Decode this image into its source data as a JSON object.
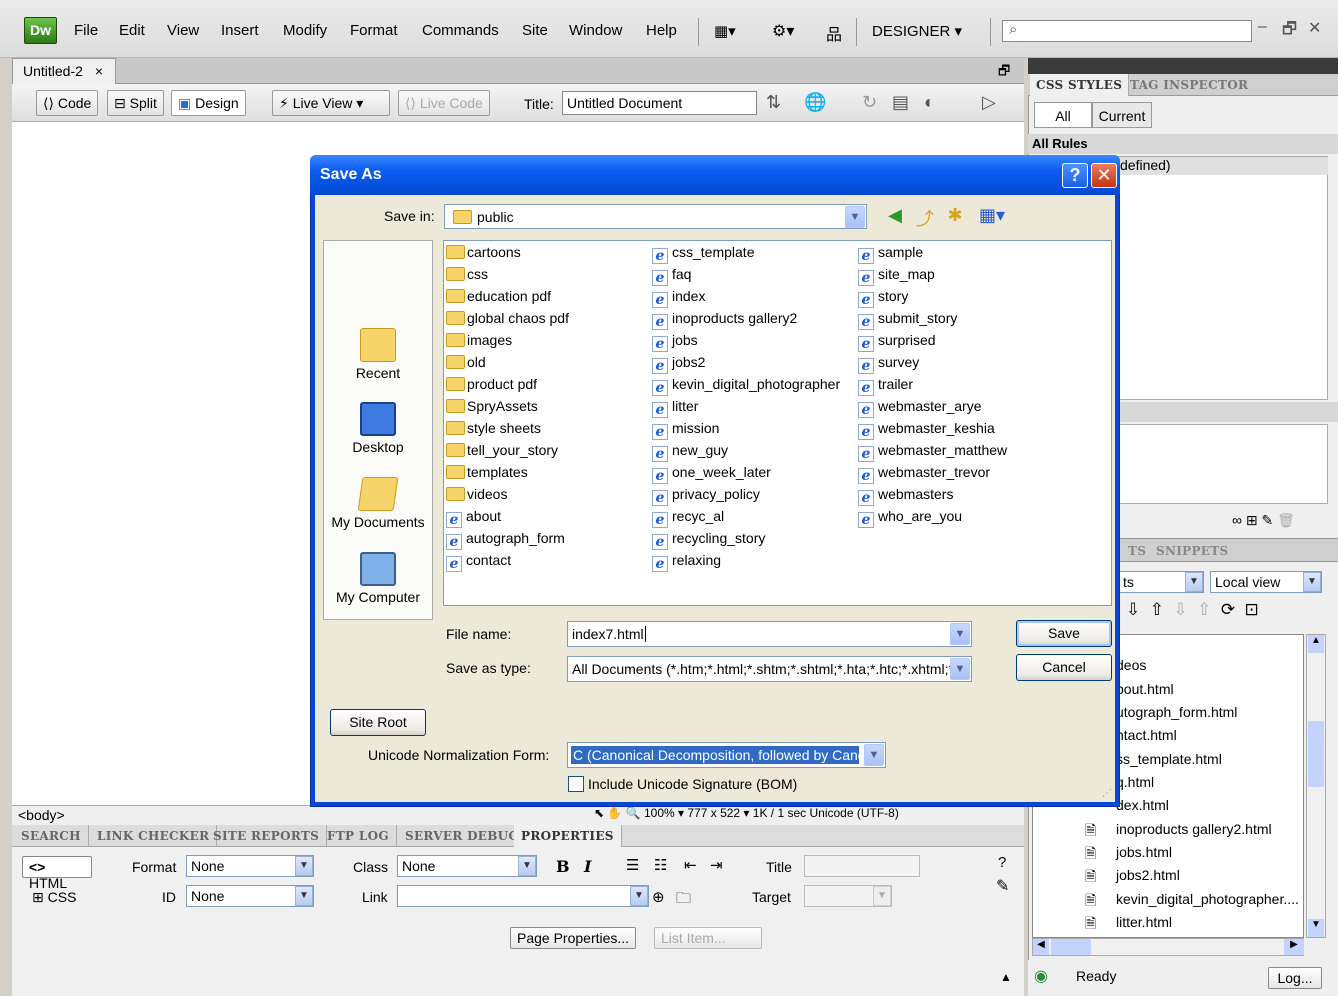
{
  "app": {
    "logo": "Dw",
    "menu": [
      "File",
      "Edit",
      "View",
      "Insert",
      "Modify",
      "Format",
      "Commands",
      "Site",
      "Window",
      "Help"
    ],
    "workspace": "DESIGNER",
    "window_controls": [
      "–",
      "🗗",
      "✕"
    ]
  },
  "document": {
    "tab": "Untitled-2",
    "tab_close": "×",
    "views": [
      "Code",
      "Split",
      "Design"
    ],
    "live_view": "Live View",
    "live_code": "Live Code",
    "title_label": "Title:",
    "title_value": "Untitled Document",
    "tag": "<body>",
    "status": "100%   ▾  777 x 522 ▾  1K / 1 sec  Unicode (UTF-8)"
  },
  "bottom_panel": {
    "tabs": [
      "SEARCH",
      "LINK CHECKER",
      "SITE REPORTS",
      "FTP LOG",
      "SERVER DEBUG",
      "PROPERTIES"
    ],
    "html_btn": "HTML",
    "css_btn": "CSS",
    "format_label": "Format",
    "format_value": "None",
    "class_label": "Class",
    "class_value": "None",
    "id_label": "ID",
    "id_value": "None",
    "link_label": "Link",
    "title_label": "Title",
    "target_label": "Target",
    "bold": "B",
    "italic": "I",
    "page_properties": "Page Properties...",
    "list_item": "List Item..."
  },
  "right_panel": {
    "tabs": [
      "CSS STYLES",
      "TAG INSPECTOR"
    ],
    "all_btn": "All",
    "current_btn": "Current",
    "all_rules": "All Rules",
    "rule_text": "defined)",
    "files_tabs": [
      "TS",
      "SNIPPETS"
    ],
    "site_select": "ts",
    "view_select": "Local view",
    "files": [
      "deos",
      "bout.html",
      "utograph_form.html",
      "ntact.html",
      "ss_template.html",
      "q.html",
      "dex.html",
      "inoproducts gallery2.html",
      "jobs.html",
      "jobs2.html",
      "kevin_digital_photographer....",
      "litter.html"
    ],
    "status": "Ready",
    "log_btn": "Log..."
  },
  "dialog": {
    "title": "Save As",
    "help": "?",
    "close": "✕",
    "save_in_label": "Save in:",
    "save_in_value": "public",
    "places": [
      "Recent",
      "Desktop",
      "My Documents",
      "My Computer"
    ],
    "col1": [
      {
        "type": "folder",
        "name": "cartoons"
      },
      {
        "type": "folder",
        "name": "css"
      },
      {
        "type": "folder",
        "name": "education pdf"
      },
      {
        "type": "folder",
        "name": "global chaos pdf"
      },
      {
        "type": "folder",
        "name": "images"
      },
      {
        "type": "folder",
        "name": "old"
      },
      {
        "type": "folder",
        "name": "product pdf"
      },
      {
        "type": "folder",
        "name": "SpryAssets"
      },
      {
        "type": "folder",
        "name": "style sheets"
      },
      {
        "type": "folder",
        "name": "tell_your_story"
      },
      {
        "type": "folder",
        "name": "templates"
      },
      {
        "type": "folder",
        "name": "videos"
      },
      {
        "type": "file",
        "name": "about"
      },
      {
        "type": "file",
        "name": "autograph_form"
      },
      {
        "type": "file",
        "name": "contact"
      }
    ],
    "col2": [
      {
        "type": "file",
        "name": "css_template"
      },
      {
        "type": "file",
        "name": "faq"
      },
      {
        "type": "file",
        "name": "index"
      },
      {
        "type": "file",
        "name": "inoproducts gallery2"
      },
      {
        "type": "file",
        "name": "jobs"
      },
      {
        "type": "file",
        "name": "jobs2"
      },
      {
        "type": "file",
        "name": "kevin_digital_photographer"
      },
      {
        "type": "file",
        "name": "litter"
      },
      {
        "type": "file",
        "name": "mission"
      },
      {
        "type": "file",
        "name": "new_guy"
      },
      {
        "type": "file",
        "name": "one_week_later"
      },
      {
        "type": "file",
        "name": "privacy_policy"
      },
      {
        "type": "file",
        "name": "recyc_al"
      },
      {
        "type": "file",
        "name": "recycling_story"
      },
      {
        "type": "file",
        "name": "relaxing"
      }
    ],
    "col3": [
      {
        "type": "file",
        "name": "sample"
      },
      {
        "type": "file",
        "name": "site_map"
      },
      {
        "type": "file",
        "name": "story"
      },
      {
        "type": "file",
        "name": "submit_story"
      },
      {
        "type": "file",
        "name": "surprised"
      },
      {
        "type": "file",
        "name": "survey"
      },
      {
        "type": "file",
        "name": "trailer"
      },
      {
        "type": "file",
        "name": "webmaster_arye"
      },
      {
        "type": "file",
        "name": "webmaster_keshia"
      },
      {
        "type": "file",
        "name": "webmaster_matthew"
      },
      {
        "type": "file",
        "name": "webmaster_trevor"
      },
      {
        "type": "file",
        "name": "webmasters"
      },
      {
        "type": "file",
        "name": "who_are_you"
      }
    ],
    "file_name_label": "File name:",
    "file_name_value": "index7.html",
    "save_type_label": "Save as type:",
    "save_type_value": "All Documents (*.htm;*.html;*.shtm;*.shtml;*.hta;*.htc;*.xhtml;*.",
    "save_btn": "Save",
    "cancel_btn": "Cancel",
    "site_root_btn": "Site Root",
    "unicode_label": "Unicode Normalization Form:",
    "unicode_value": "C (Canonical Decomposition, followed by Canonical Composition)",
    "bom_label": "Include Unicode Signature (BOM)"
  }
}
